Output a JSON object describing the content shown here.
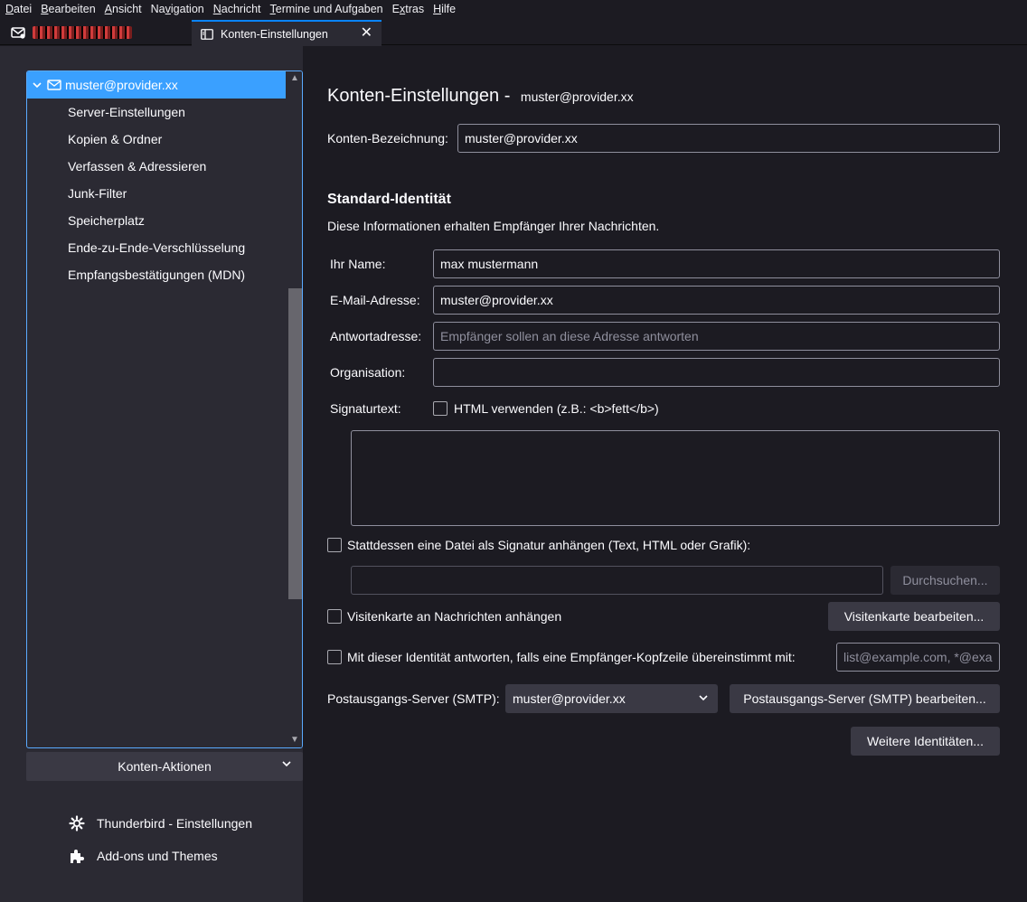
{
  "menubar": {
    "items": [
      {
        "label": "Datei",
        "key": "D"
      },
      {
        "label": "Bearbeiten",
        "key": "B"
      },
      {
        "label": "Ansicht",
        "key": "A"
      },
      {
        "label": "Navigation",
        "key": "v"
      },
      {
        "label": "Nachricht",
        "key": "N"
      },
      {
        "label": "Termine und Aufgaben",
        "key": "T"
      },
      {
        "label": "Extras",
        "key": "x"
      },
      {
        "label": "Hilfe",
        "key": "H"
      }
    ]
  },
  "tabs": {
    "active_label": "Konten-Einstellungen",
    "close_glyph": "✕"
  },
  "sidebar": {
    "account": "muster@provider.xx",
    "items": [
      "Server-Einstellungen",
      "Kopien & Ordner",
      "Verfassen & Adressieren",
      "Junk-Filter",
      "Speicherplatz",
      "Ende-zu-Ende-Verschlüsselung",
      "Empfangsbestätigungen (MDN)"
    ],
    "account_actions": "Konten-Aktionen",
    "thunderbird_settings": "Thunderbird - Einstellungen",
    "addons": "Add-ons und Themes"
  },
  "main": {
    "title": "Konten-Einstellungen -",
    "title_account": "muster@provider.xx",
    "account_name_label": "Konten-Bezeichnung:",
    "account_name_value": "muster@provider.xx",
    "identity_heading": "Standard-Identität",
    "identity_desc": "Diese Informationen erhalten Empfänger Ihrer Nachrichten.",
    "name_label": "Ihr Name:",
    "name_value": "max mustermann",
    "email_label": "E-Mail-Adresse:",
    "email_value": "muster@provider.xx",
    "reply_label": "Antwortadresse:",
    "reply_placeholder": "Empfänger sollen an diese Adresse antworten",
    "org_label": "Organisation:",
    "org_value": "",
    "sig_label": "Signaturtext:",
    "html_checkbox_label": "HTML verwenden (z.B.: <b>fett</b>)",
    "sig_file_label": "Stattdessen eine Datei als Signatur anhängen (Text, HTML oder Grafik):",
    "browse_button": "Durchsuchen...",
    "vcard_label": "Visitenkarte an Nachrichten anhängen",
    "vcard_button": "Visitenkarte bearbeiten...",
    "reply_identity_label": "Mit dieser Identität antworten, falls eine Empfänger-Kopfzeile übereinstimmt mit:",
    "reply_identity_placeholder": "list@example.com, *@example.com",
    "smtp_label": "Postausgangs-Server (SMTP):",
    "smtp_value": "muster@provider.xx",
    "smtp_button": "Postausgangs-Server (SMTP) bearbeiten...",
    "more_identities_button": "Weitere Identitäten..."
  },
  "colors": {
    "selection": "#3aa0ff",
    "focus_border": "#5aaaff",
    "background": "#1c1b22",
    "panel": "#2b2a33"
  }
}
